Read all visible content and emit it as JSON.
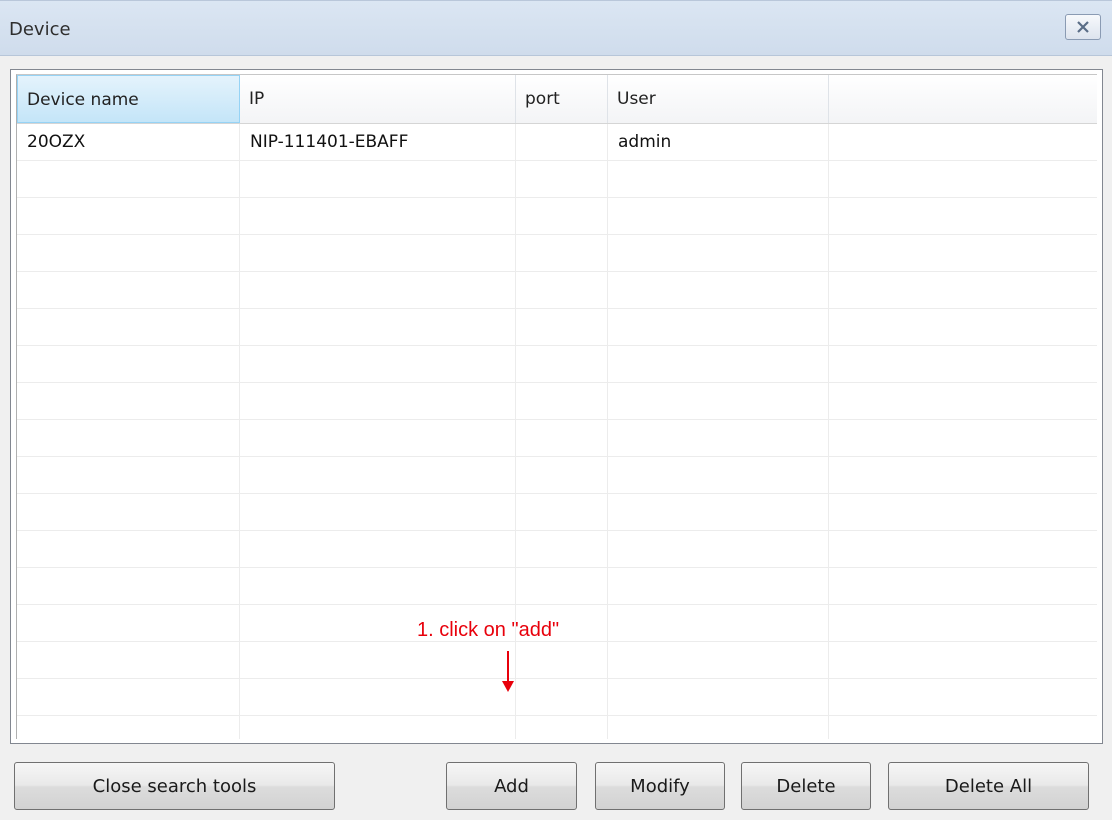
{
  "window": {
    "title": "Device",
    "close_icon": "close-x-icon"
  },
  "table": {
    "columns": [
      "Device name",
      "IP",
      "port",
      "User",
      ""
    ],
    "rows": [
      {
        "device_name": "20OZX",
        "ip": "NIP-111401-EBAFF",
        "port": "",
        "user": "admin"
      }
    ]
  },
  "annotation": {
    "text": "1. click on \"add\"",
    "color": "#e8000b"
  },
  "buttons": {
    "close_search_tools": "Close search tools",
    "add": "Add",
    "modify": "Modify",
    "delete": "Delete",
    "delete_all": "Delete All"
  }
}
